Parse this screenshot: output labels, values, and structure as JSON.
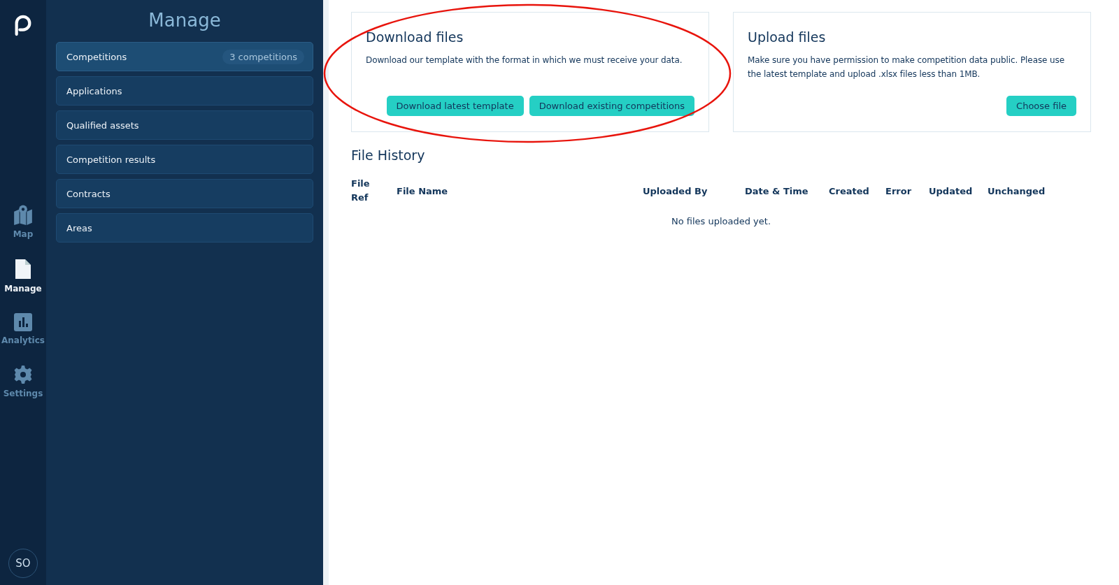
{
  "rail": {
    "items": [
      {
        "kind": "map",
        "label": "Map",
        "selected": false
      },
      {
        "kind": "document",
        "label": "Manage",
        "selected": true
      },
      {
        "kind": "chart",
        "label": "Analytics",
        "selected": false
      },
      {
        "kind": "gear",
        "label": "Settings",
        "selected": false
      }
    ],
    "avatar": "SO"
  },
  "panel": {
    "title": "Manage",
    "items": [
      {
        "label": "Competitions",
        "badge": "3 competitions",
        "selected": true
      },
      {
        "label": "Applications",
        "selected": false
      },
      {
        "label": "Qualified assets",
        "selected": false
      },
      {
        "label": "Competition results",
        "selected": false
      },
      {
        "label": "Contracts",
        "selected": false
      },
      {
        "label": "Areas",
        "selected": false
      }
    ]
  },
  "download": {
    "title": "Download files",
    "text": "Download our template with the format in which we must receive your data.",
    "buttons": [
      "Download latest template",
      "Download existing competitions"
    ],
    "annotated": true
  },
  "upload": {
    "title": "Upload files",
    "text": "Make sure you have permission to make competition data public. Please use the latest template and upload .xlsx files less than 1MB.",
    "button": "Choose file"
  },
  "history": {
    "title": "File History",
    "columns": [
      "File Ref",
      "File Name",
      "Uploaded By",
      "Date & Time",
      "Created",
      "Error",
      "Updated",
      "Unchanged"
    ],
    "empty": "No files uploaded yet."
  }
}
